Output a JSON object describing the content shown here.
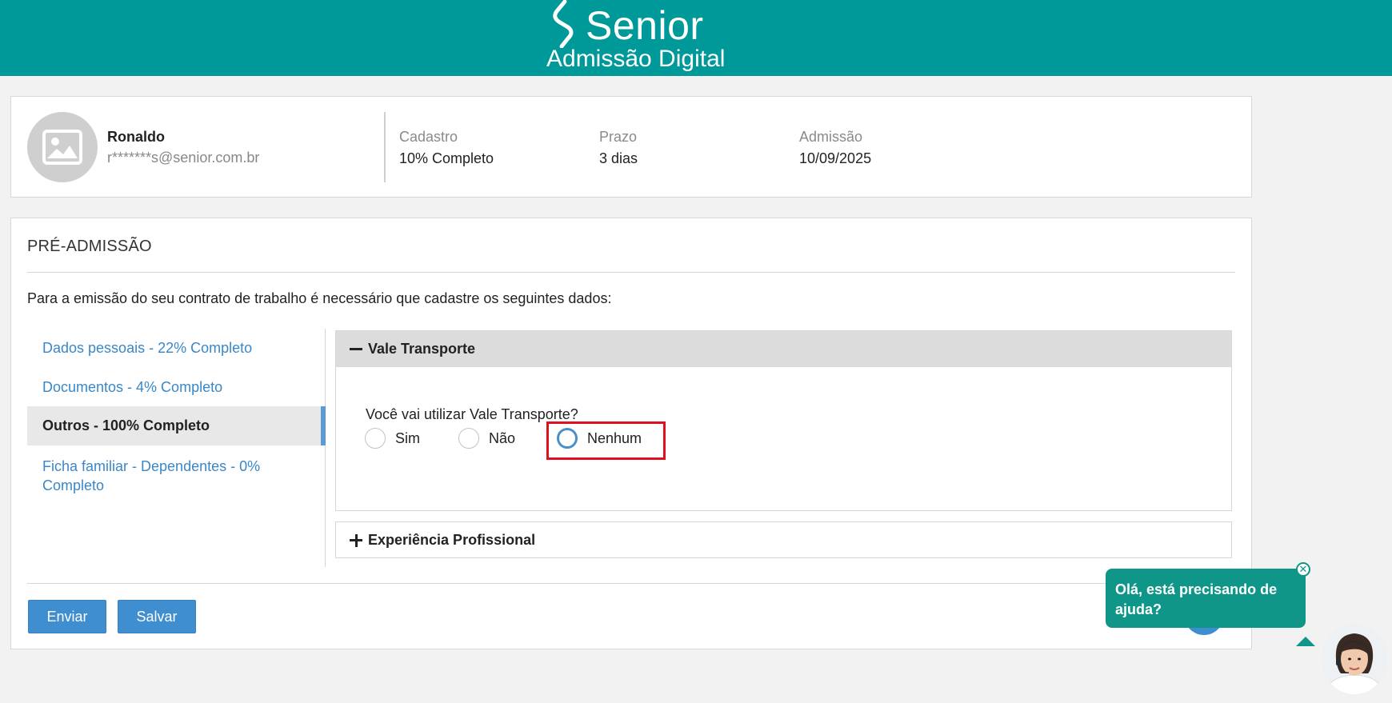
{
  "header": {
    "brand_name": "Senior",
    "brand_subtitle": "Admissão Digital",
    "background_color": "#009999"
  },
  "profile": {
    "name": "Ronaldo",
    "email": "r*******s@senior.com.br",
    "avatar_icon": "image-placeholder-icon",
    "stats": [
      {
        "label": "Cadastro",
        "value": "10% Completo"
      },
      {
        "label": "Prazo",
        "value": "3 dias"
      },
      {
        "label": "Admissão",
        "value": "10/09/2025"
      }
    ]
  },
  "panel": {
    "title": "PRÉ-ADMISSÃO",
    "description": "Para a emissão do seu contrato de trabalho é necessário que cadastre os seguintes dados:",
    "nav": [
      {
        "label": "Dados pessoais - 22% Completo",
        "active": false
      },
      {
        "label": "Documentos - 4% Completo",
        "active": false
      },
      {
        "label": "Outros - 100% Completo",
        "active": true
      },
      {
        "label": "Ficha familiar - Dependentes - 0% Completo",
        "active": false
      }
    ],
    "sections": [
      {
        "title": "Vale Transporte",
        "expanded": true,
        "question": "Você vai utilizar Vale Transporte?",
        "options": [
          "Sim",
          "Não",
          "Nenhum"
        ],
        "focused_option": "Nenhum"
      },
      {
        "title": "Experiência Profissional",
        "expanded": false
      }
    ],
    "buttons": {
      "send": "Enviar",
      "save": "Salvar"
    }
  },
  "chat": {
    "message": "Olá, está precisando de ajuda?",
    "close_symbol": "✕",
    "accent_color": "#0f9688"
  },
  "colors": {
    "link": "#3a87c8",
    "button": "#3f8ed0",
    "highlight": "#e0101f"
  }
}
